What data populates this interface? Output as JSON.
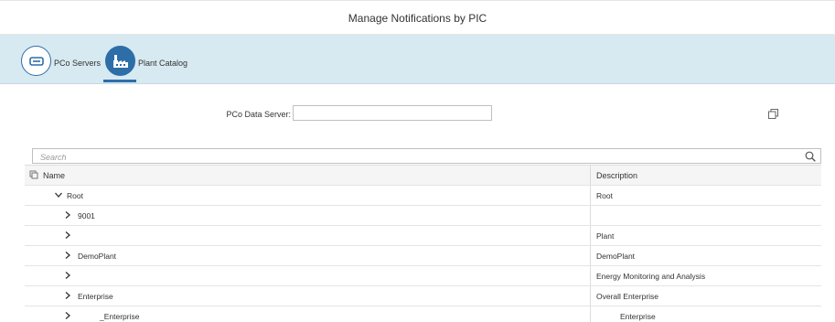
{
  "header": {
    "title": "Manage Notifications by PIC"
  },
  "nav": {
    "tabs": [
      {
        "label": "PCo Servers",
        "icon": "server-icon",
        "selected": false
      },
      {
        "label": "Plant Catalog",
        "icon": "factory-icon",
        "selected": true
      }
    ]
  },
  "form": {
    "pco_label": "PCo Data Server:",
    "pco_value": ""
  },
  "search": {
    "placeholder": "Search"
  },
  "table": {
    "columns": {
      "name": "Name",
      "description": "Description"
    },
    "rows": [
      {
        "name": "Root",
        "description": "Root",
        "expanded": true,
        "level": 0
      },
      {
        "name": "9001",
        "description": "",
        "expanded": false,
        "level": 1
      },
      {
        "name": "",
        "description": "Plant",
        "expanded": false,
        "level": 1
      },
      {
        "name": "DemoPlant",
        "description": "DemoPlant",
        "expanded": false,
        "level": 1
      },
      {
        "name": "",
        "description": "Energy Monitoring and Analysis",
        "expanded": false,
        "level": 1
      },
      {
        "name": "Enterprise",
        "description": "Overall Enterprise",
        "expanded": false,
        "level": 1
      },
      {
        "name": "_Enterprise",
        "description": "Enterprise",
        "expanded": false,
        "level": 1
      }
    ]
  },
  "colors": {
    "accent": "#2d6ea8",
    "navstrip": "#d7eaf1"
  }
}
